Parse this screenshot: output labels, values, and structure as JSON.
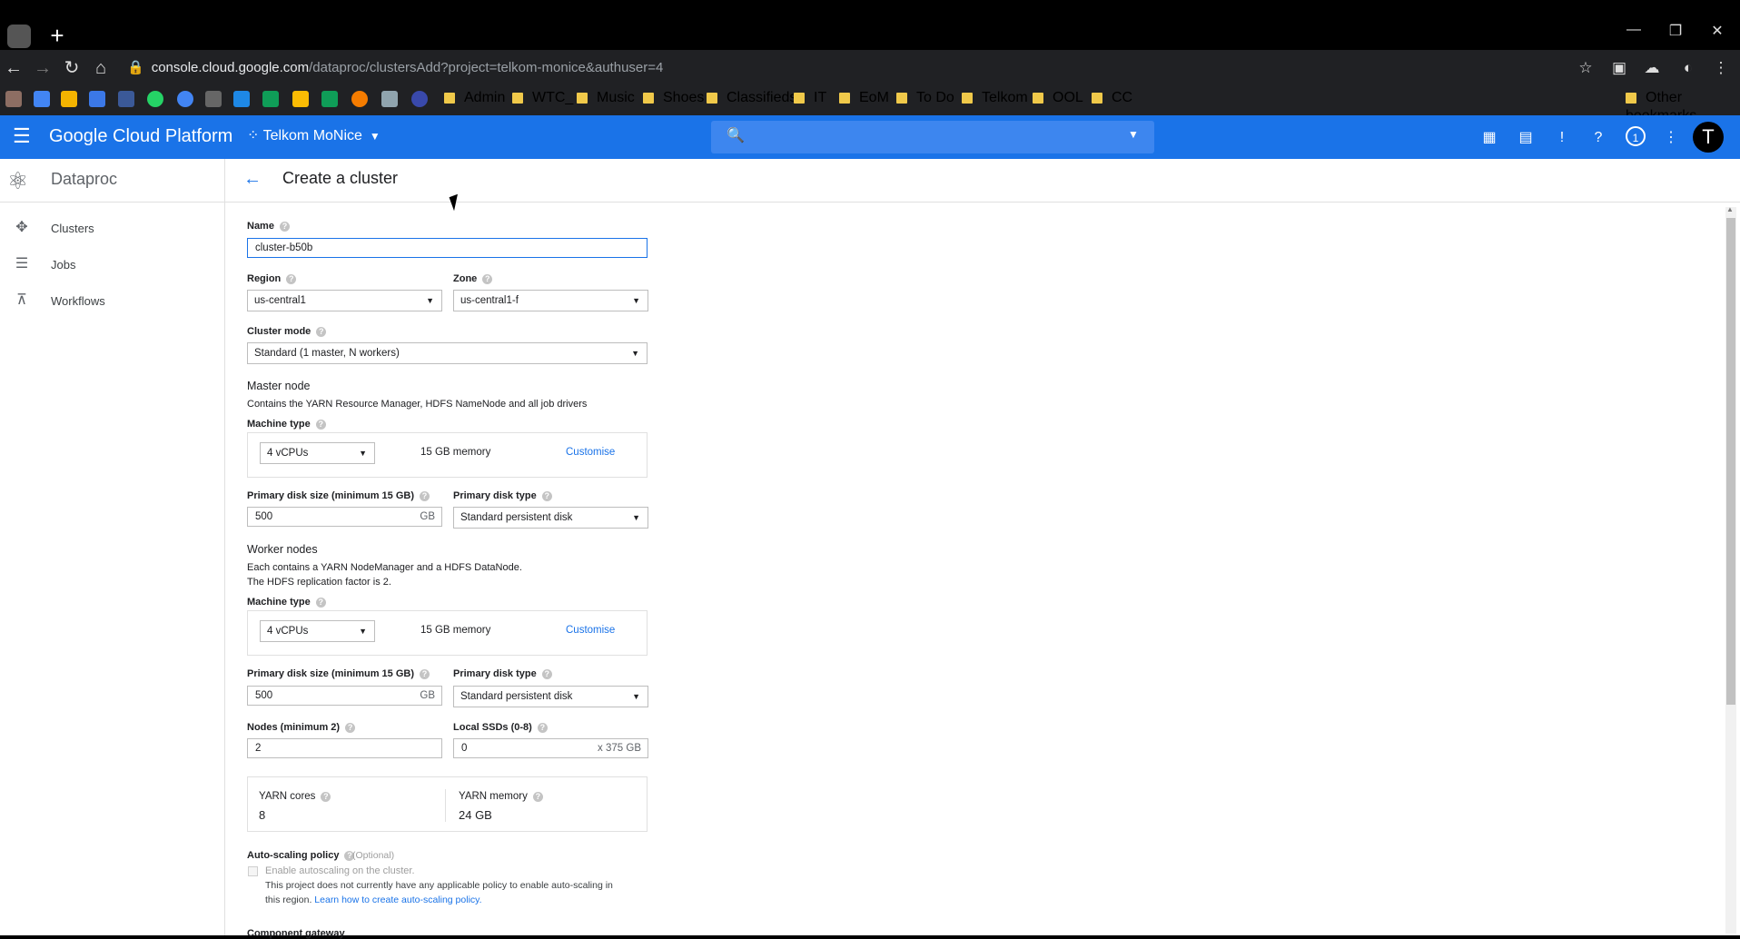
{
  "browser": {
    "url_host": "console.cloud.google.com",
    "url_path": "/dataproc/clustersAdd?project=telkom-monice&authuser=4",
    "bookmarks": [
      "Admin",
      "WTC_",
      "Music",
      "Shoes",
      "Classifieds",
      "IT",
      "EoM",
      "To Do",
      "Telkom",
      "OOL",
      "CC"
    ],
    "other_bookmarks": "Other bookmarks"
  },
  "header": {
    "app_title": "Google Cloud Platform",
    "project": "Telkom MoNice",
    "notifications": "1",
    "avatar_letter": "T"
  },
  "sidebar": {
    "product": "Dataproc",
    "items": [
      {
        "label": "Clusters",
        "icon": "clusters-icon"
      },
      {
        "label": "Jobs",
        "icon": "list-icon"
      },
      {
        "label": "Workflows",
        "icon": "workflow-icon"
      }
    ]
  },
  "page": {
    "title": "Create a cluster",
    "name_label": "Name",
    "name_value": "cluster-b50b",
    "region_label": "Region",
    "region_value": "us-central1",
    "zone_label": "Zone",
    "zone_value": "us-central1-f",
    "cluster_mode_label": "Cluster mode",
    "cluster_mode_value": "Standard (1 master, N workers)",
    "master": {
      "heading": "Master node",
      "desc": "Contains the YARN Resource Manager, HDFS NameNode and all job drivers",
      "machine_type_label": "Machine type",
      "machine_type_value": "4 vCPUs",
      "memory": "15 GB memory",
      "customise": "Customise",
      "disk_size_label": "Primary disk size (minimum 15 GB)",
      "disk_size_value": "500",
      "disk_unit": "GB",
      "disk_type_label": "Primary disk type",
      "disk_type_value": "Standard persistent disk"
    },
    "worker": {
      "heading": "Worker nodes",
      "desc1": "Each contains a YARN NodeManager and a HDFS DataNode.",
      "desc2": "The HDFS replication factor is 2.",
      "machine_type_label": "Machine type",
      "machine_type_value": "4 vCPUs",
      "memory": "15 GB memory",
      "customise": "Customise",
      "disk_size_label": "Primary disk size (minimum 15 GB)",
      "disk_size_value": "500",
      "disk_unit": "GB",
      "disk_type_label": "Primary disk type",
      "disk_type_value": "Standard persistent disk",
      "nodes_label": "Nodes (minimum 2)",
      "nodes_value": "2",
      "ssd_label": "Local SSDs (0-8)",
      "ssd_value": "0",
      "ssd_unit": "x 375 GB"
    },
    "yarn": {
      "cores_label": "YARN cores",
      "cores_value": "8",
      "memory_label": "YARN memory",
      "memory_value": "24 GB"
    },
    "autoscaling": {
      "label": "Auto-scaling policy",
      "optional": "(Optional)",
      "checkbox_label": "Enable autoscaling on the cluster.",
      "note1": "This project does not currently have any applicable policy to enable auto-scaling in",
      "note2_prefix": "this region.",
      "note2_link": "Learn how to create auto-scaling policy."
    },
    "component_gateway_label": "Component gateway"
  }
}
